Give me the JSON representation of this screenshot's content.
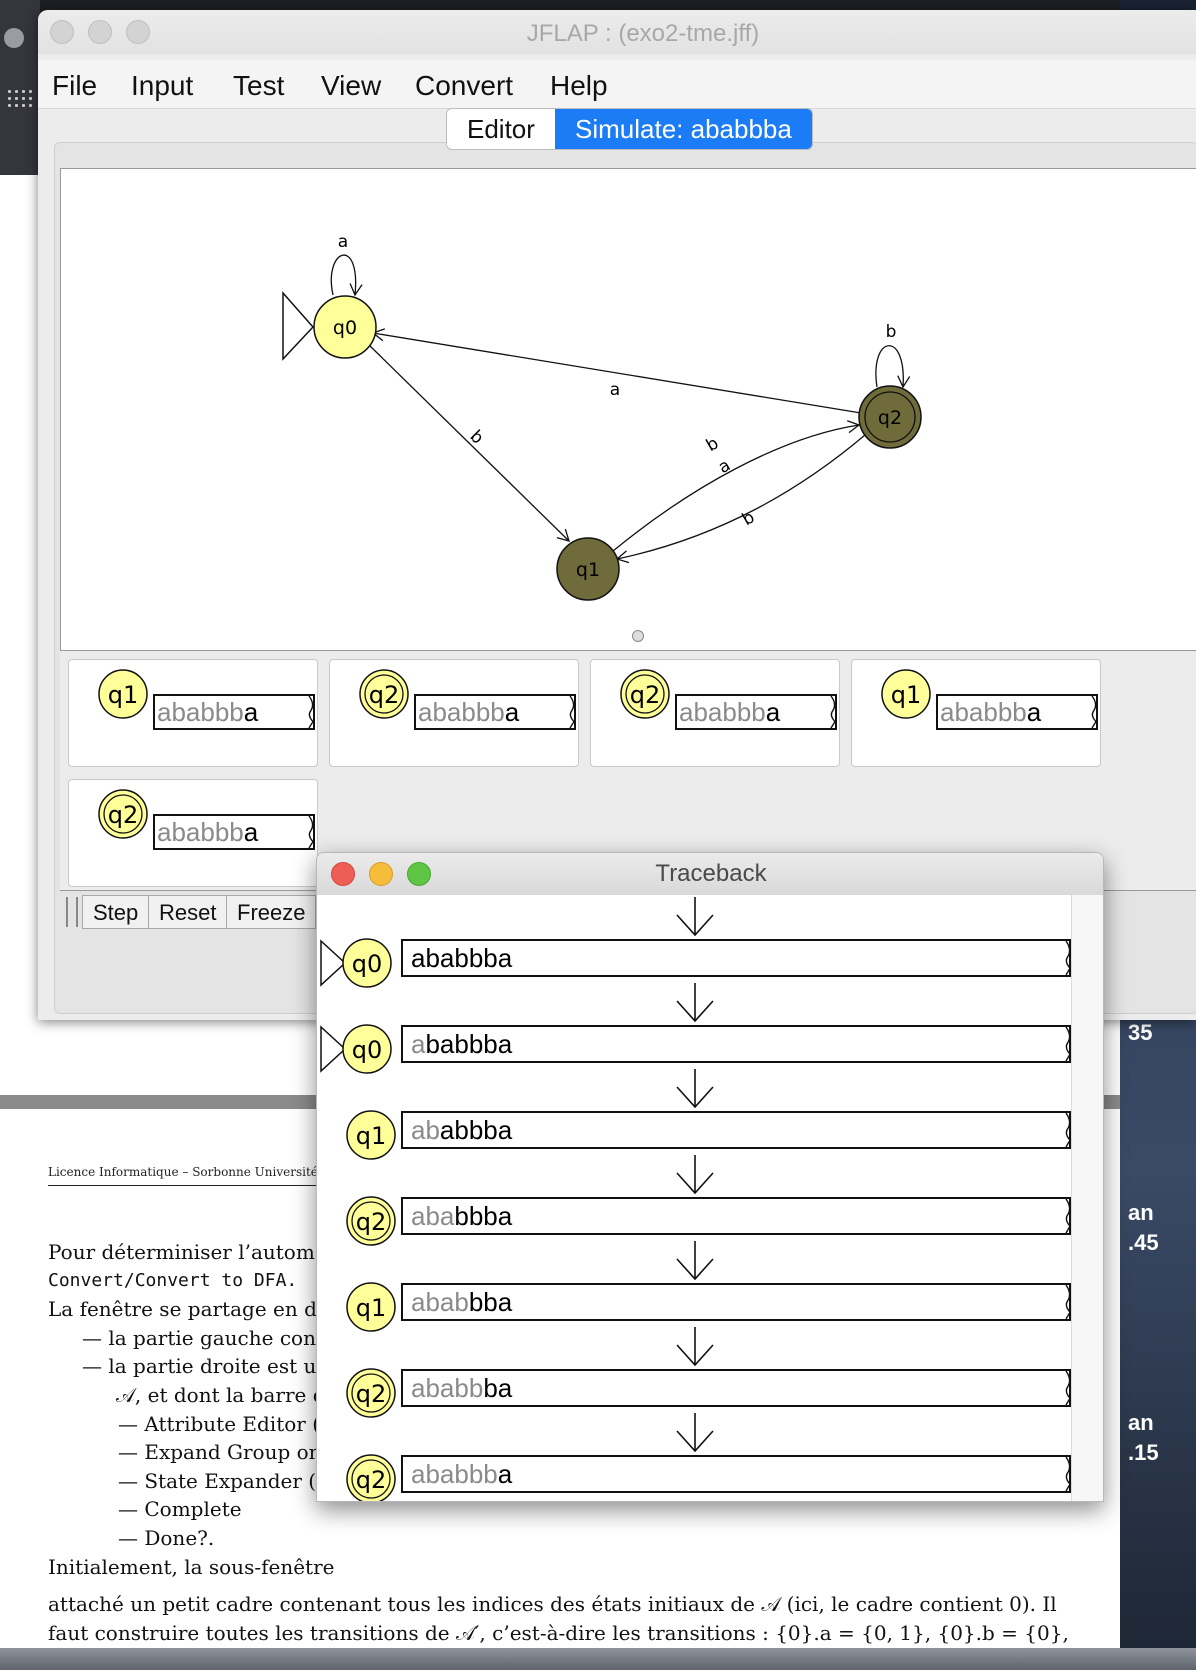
{
  "window": {
    "title": "JFLAP : (exo2-tme.jff)",
    "menu": [
      "File",
      "Input",
      "Test",
      "View",
      "Convert",
      "Help"
    ],
    "tabs": {
      "editor": "Editor",
      "simulate": "Simulate: ababbba"
    }
  },
  "automaton": {
    "states": [
      {
        "name": "q0",
        "initial": true,
        "final": false,
        "highlighted": false
      },
      {
        "name": "q1",
        "initial": false,
        "final": false,
        "highlighted": true
      },
      {
        "name": "q2",
        "initial": false,
        "final": true,
        "highlighted": true
      }
    ],
    "transitions": [
      {
        "from": "q0",
        "to": "q0",
        "label": "a"
      },
      {
        "from": "q0",
        "to": "q1",
        "label": "b"
      },
      {
        "from": "q2",
        "to": "q0",
        "label": "a"
      },
      {
        "from": "q1",
        "to": "q2",
        "label": "b"
      },
      {
        "from": "q1",
        "to": "q2",
        "label": "a"
      },
      {
        "from": "q2",
        "to": "q1",
        "label": "b"
      },
      {
        "from": "q2",
        "to": "q2",
        "label": "b"
      }
    ],
    "colors": {
      "state_fill": "#ffff99",
      "state_active": "#6f6b3a"
    }
  },
  "configurations": [
    {
      "state": "q1",
      "final": false,
      "read": "ababbb",
      "rest": "a"
    },
    {
      "state": "q2",
      "final": true,
      "read": "ababbb",
      "rest": "a"
    },
    {
      "state": "q2",
      "final": true,
      "read": "ababbb",
      "rest": "a"
    },
    {
      "state": "q1",
      "final": false,
      "read": "ababbb",
      "rest": "a"
    },
    {
      "state": "q2",
      "final": true,
      "read": "ababbb",
      "rest": "a"
    }
  ],
  "buttons": {
    "step": "Step",
    "reset": "Reset",
    "freeze": "Freeze"
  },
  "traceback": {
    "title": "Traceback",
    "rows": [
      {
        "state": "q0",
        "initial": true,
        "final": false,
        "read": "",
        "rest": "ababbba"
      },
      {
        "state": "q0",
        "initial": true,
        "final": false,
        "read": "a",
        "rest": "babbba"
      },
      {
        "state": "q1",
        "initial": false,
        "final": false,
        "read": "ab",
        "rest": "abbba"
      },
      {
        "state": "q2",
        "initial": false,
        "final": true,
        "read": "aba",
        "rest": "bbba"
      },
      {
        "state": "q1",
        "initial": false,
        "final": false,
        "read": "abab",
        "rest": "bba"
      },
      {
        "state": "q2",
        "initial": false,
        "final": true,
        "read": "ababb",
        "rest": "ba"
      },
      {
        "state": "q2",
        "initial": false,
        "final": true,
        "read": "ababbb",
        "rest": "a"
      }
    ]
  },
  "document": {
    "header": "Licence Informatique – Sorbonne Université",
    "line1": "Pour déterminiser l’automat",
    "line2": "Convert/Convert to DFA.",
    "line3": "La fenêtre se partage en deu",
    "bullet1": "— la partie gauche conti",
    "bullet2": "— la partie droite est un",
    "bullet2b": "𝒜, et dont la barre d’",
    "sub": [
      "— Attribute Editor (",
      "— Expand Group on",
      "— State Expander (",
      "— Complete",
      "— Done?."
    ],
    "line_init": "Initialement, la sous-fenêtre",
    "tail1": "attaché un petit cadre contenant tous les indices des états initiaux de 𝒜 (ici, le cadre contient 0). Il",
    "tail2": "faut construire toutes les transitions de 𝒜′, c’est-à-dire les transitions  : {0}.a = {0, 1}, {0}.b = {0},"
  },
  "desktop": {
    "fragments": [
      "an",
      "35",
      "an",
      ".45",
      "an",
      ".15"
    ]
  }
}
